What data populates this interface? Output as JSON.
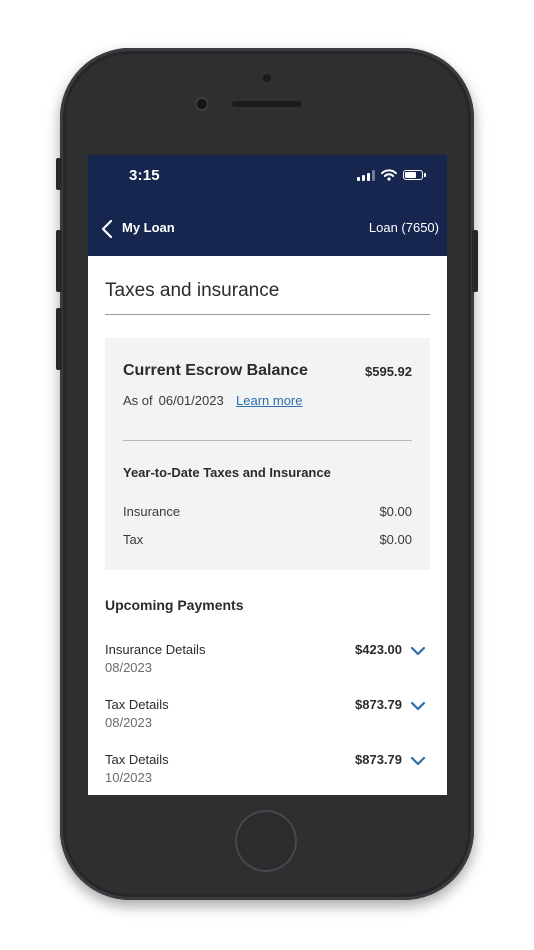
{
  "status_bar": {
    "time": "3:15"
  },
  "nav": {
    "title": "My Loan",
    "loan_id": "Loan (7650)",
    "back_icon": "chevron-left-icon"
  },
  "page": {
    "title": "Taxes and insurance"
  },
  "escrow": {
    "label": "Current Escrow Balance",
    "amount": "$595.92",
    "as_of_label": "As of",
    "as_of_date": "06/01/2023",
    "learn_more": "Learn more",
    "ytd_title": "Year-to-Date Taxes and Insurance",
    "rows": [
      {
        "label": "Insurance",
        "value": "$0.00"
      },
      {
        "label": "Tax",
        "value": "$0.00"
      }
    ]
  },
  "upcoming": {
    "title": "Upcoming Payments",
    "items": [
      {
        "name": "Insurance Details",
        "date": "08/2023",
        "amount": "$423.00"
      },
      {
        "name": "Tax Details",
        "date": "08/2023",
        "amount": "$873.79"
      },
      {
        "name": "Tax Details",
        "date": "10/2023",
        "amount": "$873.79"
      }
    ]
  },
  "colors": {
    "nav_bg": "#16264e",
    "link": "#2f6ea8",
    "card_bg": "#f2f3f5"
  }
}
